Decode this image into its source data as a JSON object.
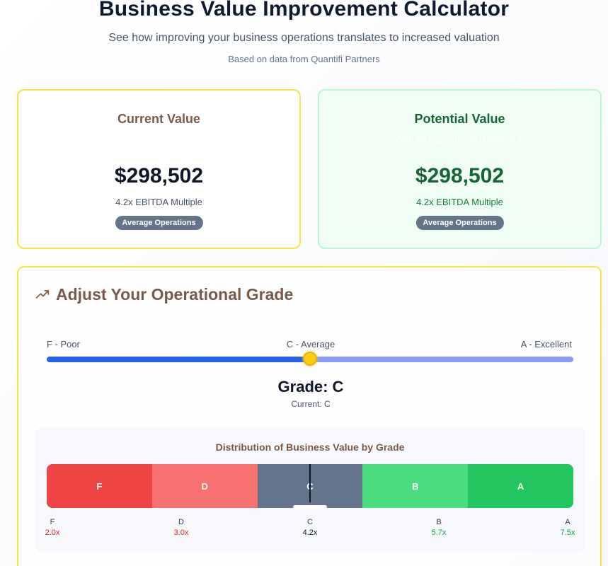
{
  "header": {
    "title": "Business Value Improvement Calculator",
    "subtitle": "See how improving your business operations translates to increased valuation",
    "source": "Based on data from Quantifi Partners"
  },
  "current": {
    "title": "Current Value",
    "value": "$298,502",
    "multiple": "4.2x EBITDA Multiple",
    "badge": "Average Operations"
  },
  "potential": {
    "title": "Potential Value",
    "subtitle": "With an Operational Grade of C",
    "value": "$298,502",
    "multiple": "4.2x EBITDA Multiple",
    "badge": "Average Operations"
  },
  "adjust": {
    "icon": "trending-up-icon",
    "title": "Adjust Your Operational Grade",
    "min_label": "F - Poor",
    "mid_label": "C - Average",
    "max_label": "A - Excellent",
    "slider_value": 0.5,
    "grade_label": "Grade: C",
    "current_label": "Current: C"
  },
  "distribution": {
    "title": "Distribution of Business Value by Grade",
    "marker_position": 0.5,
    "segments": [
      {
        "grade": "F",
        "multiple": "2.0x",
        "color": "#ef4444",
        "label_color": "#dc2626"
      },
      {
        "grade": "D",
        "multiple": "3.0x",
        "color": "#f87171",
        "label_color": "#dc2626"
      },
      {
        "grade": "C",
        "multiple": "4.2x",
        "color": "#64748b",
        "label_color": "#0f172a"
      },
      {
        "grade": "B",
        "multiple": "5.7x",
        "color": "#4ade80",
        "label_color": "#16a34a"
      },
      {
        "grade": "A",
        "multiple": "7.5x",
        "color": "#22c55e",
        "label_color": "#16a34a"
      }
    ]
  }
}
